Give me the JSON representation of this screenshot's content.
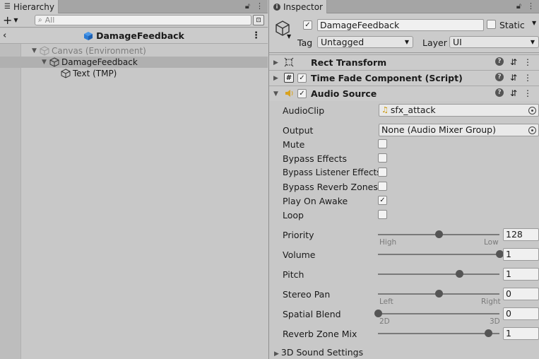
{
  "hierarchy": {
    "tab_label": "Hierarchy",
    "search_placeholder": "All",
    "prefab_title": "DamageFeedback",
    "items": [
      {
        "label": "Canvas (Environment)",
        "muted": true
      },
      {
        "label": "DamageFeedback",
        "selected": true
      },
      {
        "label": "Text (TMP)"
      }
    ]
  },
  "inspector": {
    "tab_label": "Inspector",
    "object_name": "DamageFeedback",
    "static_label": "Static",
    "tag_label": "Tag",
    "tag_value": "Untagged",
    "layer_label": "Layer",
    "layer_value": "UI",
    "components": {
      "rect_transform": "Rect Transform",
      "time_fade": "Time Fade Component (Script)",
      "audio_source": "Audio Source"
    },
    "audio": {
      "audioclip_label": "AudioClip",
      "audioclip_value": "sfx_attack",
      "output_label": "Output",
      "output_value": "None (Audio Mixer Group)",
      "mute_label": "Mute",
      "mute": false,
      "bypass_effects_label": "Bypass Effects",
      "bypass_effects": false,
      "bypass_listener_label": "Bypass Listener Effects",
      "bypass_listener": false,
      "bypass_reverb_label": "Bypass Reverb Zones",
      "bypass_reverb": false,
      "play_on_awake_label": "Play On Awake",
      "play_on_awake": true,
      "loop_label": "Loop",
      "loop": false,
      "priority_label": "Priority",
      "priority_value": "128",
      "priority_min": 0,
      "priority_max": 256,
      "priority_left": "High",
      "priority_right": "Low",
      "volume_label": "Volume",
      "volume_value": "1",
      "pitch_label": "Pitch",
      "pitch_value": "1",
      "pitch_min": -3,
      "pitch_max": 3,
      "stereo_pan_label": "Stereo Pan",
      "stereo_pan_value": "0",
      "stereo_left": "Left",
      "stereo_right": "Right",
      "spatial_blend_label": "Spatial Blend",
      "spatial_blend_value": "0",
      "spatial_left": "2D",
      "spatial_right": "3D",
      "reverb_mix_label": "Reverb Zone Mix",
      "reverb_mix_value": "1",
      "reverb_mix_max": 1.1,
      "sound_settings_label": "3D Sound Settings"
    }
  },
  "colors": {
    "panel": "#c8c8c8",
    "selection": "#b0b0b0",
    "prefab_blue": "#2a7bd5",
    "audio_icon": "#d8a21f"
  }
}
